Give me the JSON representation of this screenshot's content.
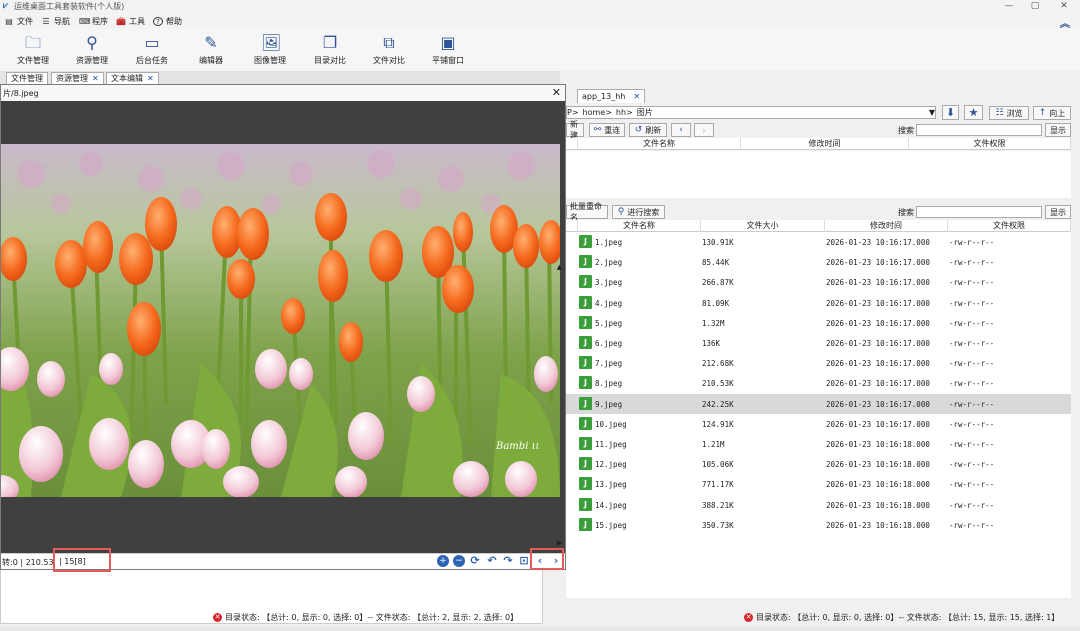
{
  "window": {
    "title": "运维桌面工具套装软件(个人版)",
    "min": "—",
    "max": "▢",
    "close": "✕",
    "collapse": "︽"
  },
  "menu": [
    {
      "icon": "▤",
      "label": "文件"
    },
    {
      "icon": "☰",
      "label": "导航"
    },
    {
      "icon": "⌨",
      "label": "程序"
    },
    {
      "icon": "🧰",
      "label": "工具"
    },
    {
      "icon": "?",
      "label": "帮助"
    }
  ],
  "toolbar": [
    {
      "icon": "🗀",
      "label": "文件管理"
    },
    {
      "icon": "⚲",
      "label": "资源管理"
    },
    {
      "icon": "▭",
      "label": "后台任务"
    },
    {
      "icon": "✎",
      "label": "编辑器"
    },
    {
      "icon": "🖼",
      "label": "图像管理"
    },
    {
      "icon": "❐",
      "label": "目录对比"
    },
    {
      "icon": "⧉",
      "label": "文件对比"
    },
    {
      "icon": "▣",
      "label": "平铺窗口"
    }
  ],
  "left_tabs": [
    {
      "label": "文件管理",
      "close": ""
    },
    {
      "label": "资源管理",
      "close": "✕"
    },
    {
      "label": "文本编辑",
      "close": "✕"
    }
  ],
  "image_viewer": {
    "title": "片/8.jpeg",
    "close": "✕",
    "watermark": "Bambi ιι",
    "footer_info1": "转:0 | 210.53",
    "footer_info2": "| 15[8]",
    "prev": "‹",
    "next": "›",
    "up": "▲",
    "down": "▶"
  },
  "left_status": "目录状态: 【总计: 0, 显示: 0, 选择: 0】-- 文件状态: 【总计: 2, 显示: 2, 选择: 0】",
  "right_panel": {
    "tab": {
      "label": "app_13_hh",
      "close": "✕"
    },
    "path": [
      "P>",
      "home>",
      "hh>",
      "图片"
    ],
    "buttons": {
      "browse": "浏览",
      "up": "向上",
      "new": "新建",
      "rename": "重连",
      "refresh": "刷新",
      "show": "显示",
      "show2": "显示",
      "batch": "批量重命名",
      "search_go": "进行搜索"
    },
    "search_label": "搜索",
    "search_label2": "搜索",
    "dir_columns": [
      "文件名称",
      "修改时间",
      "文件权限"
    ],
    "file_columns": [
      "文件名称",
      "文件大小",
      "修改时间",
      "文件权限"
    ],
    "files": [
      {
        "name": "1.jpeg",
        "size": "130.91K",
        "mtime": "2026-01-23 10:16:17.000",
        "perm": "-rw-r--r--"
      },
      {
        "name": "2.jpeg",
        "size": "85.44K",
        "mtime": "2026-01-23 10:16:17.000",
        "perm": "-rw-r--r--"
      },
      {
        "name": "3.jpeg",
        "size": "266.87K",
        "mtime": "2026-01-23 10:16:17.000",
        "perm": "-rw-r--r--"
      },
      {
        "name": "4.jpeg",
        "size": "81.09K",
        "mtime": "2026-01-23 10:16:17.000",
        "perm": "-rw-r--r--"
      },
      {
        "name": "5.jpeg",
        "size": "1.32M",
        "mtime": "2026-01-23 10:16:17.000",
        "perm": "-rw-r--r--"
      },
      {
        "name": "6.jpeg",
        "size": "136K",
        "mtime": "2026-01-23 10:16:17.000",
        "perm": "-rw-r--r--"
      },
      {
        "name": "7.jpeg",
        "size": "212.68K",
        "mtime": "2026-01-23 10:16:17.000",
        "perm": "-rw-r--r--"
      },
      {
        "name": "8.jpeg",
        "size": "210.53K",
        "mtime": "2026-01-23 10:16:17.000",
        "perm": "-rw-r--r--"
      },
      {
        "name": "9.jpeg",
        "size": "242.25K",
        "mtime": "2026-01-23 10:16:17.000",
        "perm": "-rw-r--r--"
      },
      {
        "name": "10.jpeg",
        "size": "124.91K",
        "mtime": "2026-01-23 10:16:17.000",
        "perm": "-rw-r--r--"
      },
      {
        "name": "11.jpeg",
        "size": "1.21M",
        "mtime": "2026-01-23 10:16:18.000",
        "perm": "-rw-r--r--"
      },
      {
        "name": "12.jpeg",
        "size": "105.06K",
        "mtime": "2026-01-23 10:16:18.000",
        "perm": "-rw-r--r--"
      },
      {
        "name": "13.jpeg",
        "size": "771.17K",
        "mtime": "2026-01-23 10:16:18.000",
        "perm": "-rw-r--r--"
      },
      {
        "name": "14.jpeg",
        "size": "388.21K",
        "mtime": "2026-01-23 10:16:18.000",
        "perm": "-rw-r--r--"
      },
      {
        "name": "15.jpeg",
        "size": "350.73K",
        "mtime": "2026-01-23 10:16:18.000",
        "perm": "-rw-r--r--"
      }
    ],
    "selected_index": 8,
    "status": "目录状态: 【总计: 0, 显示: 0, 选择: 0】-- 文件状态: 【总计: 15, 显示: 15, 选择: 1】"
  }
}
